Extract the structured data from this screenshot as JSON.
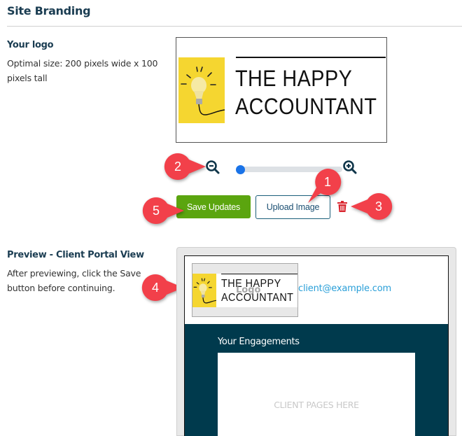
{
  "section": {
    "title": "Site Branding"
  },
  "logo": {
    "label": "Your logo",
    "description": "Optimal size: 200 pixels wide x 100 pixels tall",
    "description_line1": "Optimal size: 200 pixels wide x 100",
    "description_line2": "pixels tall",
    "text_line1": "THE HAPPY",
    "text_line2": "ACCOUNTANT",
    "zoom_out_icon": "zoom-out-icon",
    "zoom_in_icon": "zoom-in-icon",
    "zoom_level": 0
  },
  "buttons": {
    "save": "Save Updates",
    "upload": "Upload Image",
    "delete_icon": "trash-icon"
  },
  "callouts": [
    "1",
    "2",
    "3",
    "4",
    "5"
  ],
  "preview": {
    "label": "Preview - Client Portal View",
    "description_line1": "After previewing, click the Save",
    "description_line2": "button before continuing.",
    "logo_overlay": "Logo",
    "client_email": "client@example.com",
    "engagements_title": "Your Engagements",
    "client_pages_placeholder": "CLIENT PAGES HERE"
  },
  "colors": {
    "accent_blue": "#1a73e8",
    "save_green": "#5ba50f",
    "portal_dark": "#003a4d",
    "callout_red": "#f2404a",
    "link_blue": "#2a9fd8"
  }
}
